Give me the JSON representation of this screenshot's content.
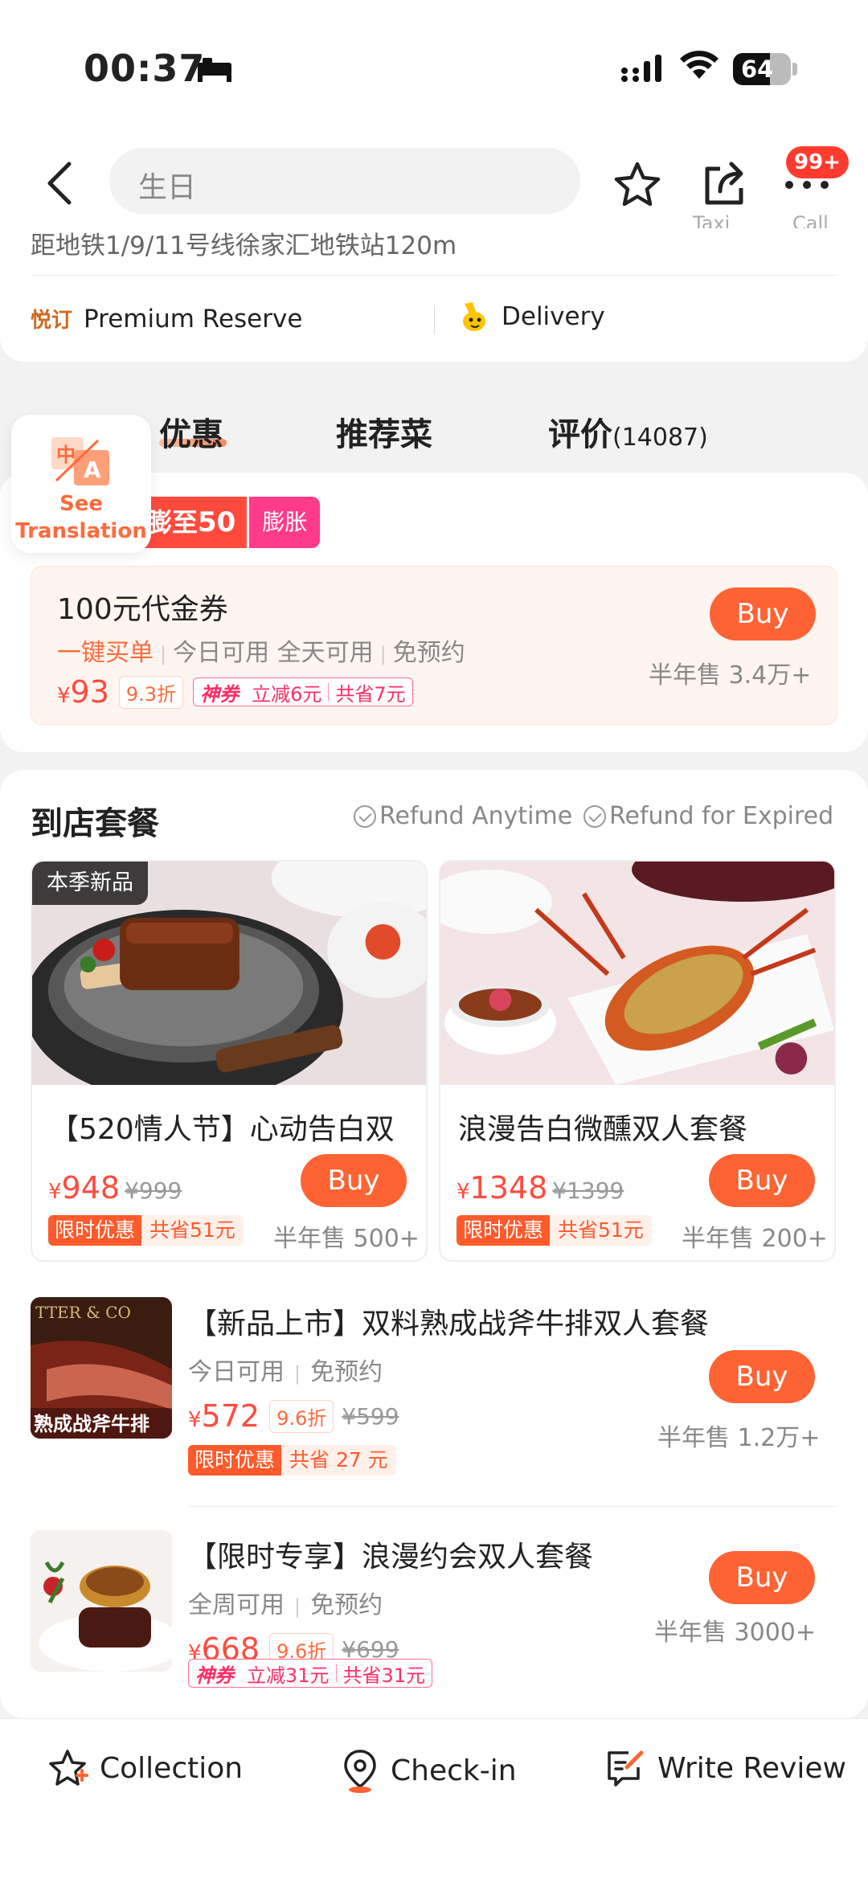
{
  "status": {
    "time": "00:37",
    "battery": "64",
    "battery_level": 0.64
  },
  "header": {
    "search_text": "生日",
    "badge": "99+",
    "peek_labels": [
      "Taxi",
      "Call"
    ],
    "address": "距地铁1/9/11号线徐家汇地铁站120m",
    "premium_logo": "悦订",
    "premium_label": "Premium Reserve",
    "delivery_label": "Delivery"
  },
  "translate": {
    "line1": "See",
    "line2": "Translation"
  },
  "tabs": [
    {
      "label": "优惠",
      "active": true
    },
    {
      "label": "推荐菜"
    },
    {
      "label": "评价",
      "count": "(14087)"
    }
  ],
  "voucher_section": {
    "tag_prefix": "膨至",
    "tag_value": "50",
    "tag_label": "膨胀",
    "voucher": {
      "title": "100元代金券",
      "highlight": "一键买单",
      "features": [
        "今日可用 全天可用",
        "免预约"
      ],
      "currency": "¥",
      "price": "93",
      "discount": "9.3折",
      "shenquan_brand": "神券",
      "shenquan_off": "立减6元",
      "shenquan_save": "共省7元",
      "buy": "Buy",
      "sold": "半年售 3.4万+"
    }
  },
  "packages": {
    "title": "到店套餐",
    "refund1": "Refund Anytime",
    "refund2": "Refund for Expired",
    "grid": [
      {
        "tag": "本季新品",
        "name": "【520情人节】心动告白双",
        "currency": "¥",
        "price": "948",
        "old_price": "¥999",
        "limit": "限时优惠",
        "save": "共省51元",
        "buy": "Buy",
        "sold": "半年售 500+"
      },
      {
        "name": "浪漫告白微醺双人套餐",
        "currency": "¥",
        "price": "1348",
        "old_price": "¥1399",
        "limit": "限时优惠",
        "save": "共省51元",
        "buy": "Buy",
        "sold": "半年售 200+"
      }
    ],
    "list": [
      {
        "thumb_text": "熟成战斧牛排",
        "thumb_bg_text": "TTER & CO",
        "name": "【新品上市】双料熟成战斧牛排双人套餐",
        "meta1": "今日可用",
        "meta2": "免预约",
        "currency": "¥",
        "price": "572",
        "discount": "9.6折",
        "old_price": "¥599",
        "limit": "限时优惠",
        "save": "共省 27 元",
        "buy": "Buy",
        "sold": "半年售 1.2万+"
      },
      {
        "name": "【限时专享】浪漫约会双人套餐",
        "meta1": "全周可用",
        "meta2": "免预约",
        "currency": "¥",
        "price": "668",
        "discount": "9.6折",
        "old_price": "¥699",
        "shenquan_brand": "神券",
        "shenquan_off": "立减31元",
        "shenquan_save": "共省31元",
        "buy": "Buy",
        "sold": "半年售 3000+"
      }
    ]
  },
  "bottom": {
    "collection": "Collection",
    "checkin": "Check-in",
    "review": "Write Review"
  },
  "colors": {
    "accent": "#ff6333",
    "price": "#ff4b3e",
    "shenquan": "#ff2e66"
  }
}
